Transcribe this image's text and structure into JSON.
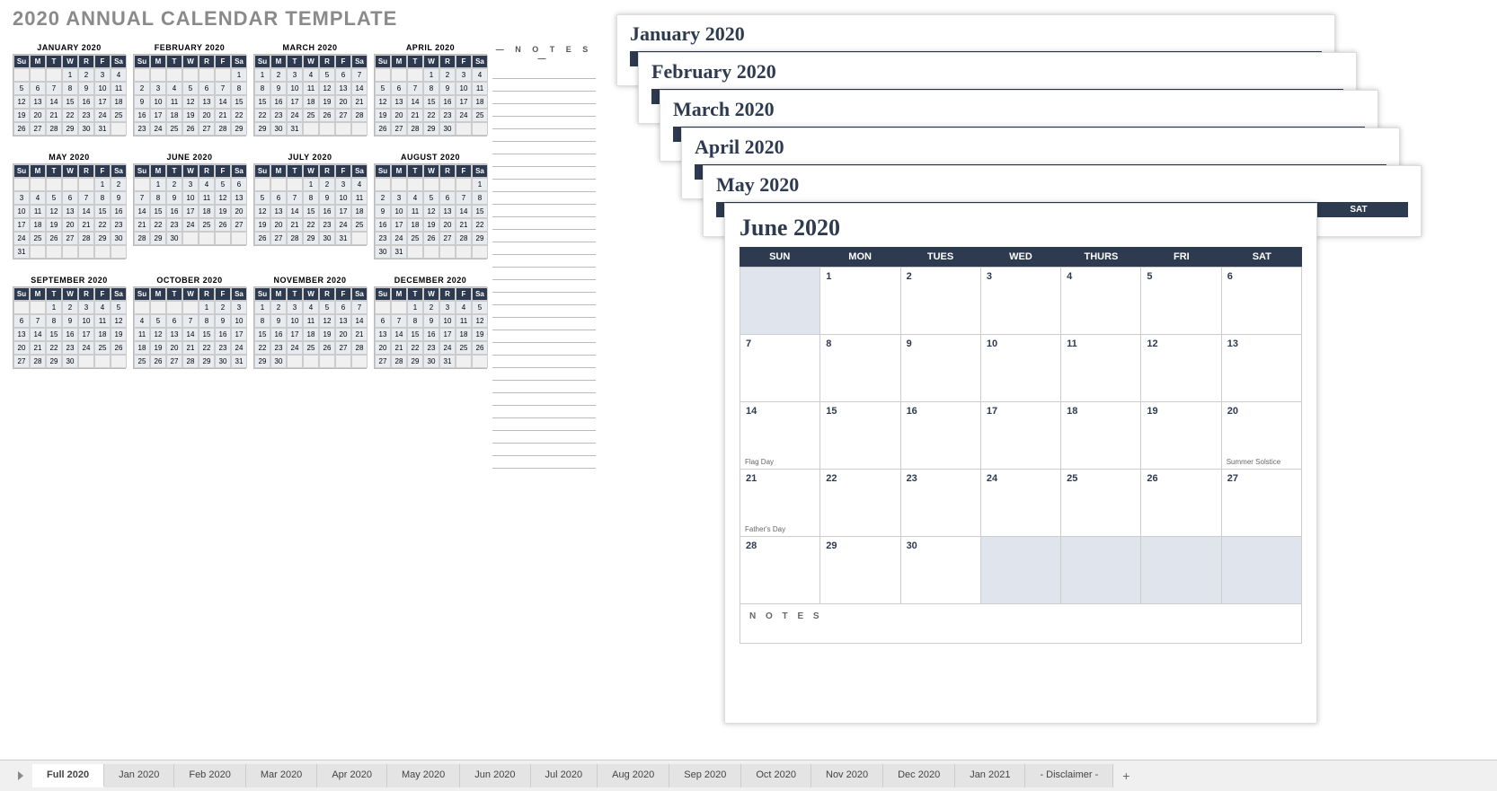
{
  "title": "2020 ANNUAL CALENDAR TEMPLATE",
  "notes_label": "— N O T E S —",
  "mini_day_headers": [
    "Su",
    "M",
    "T",
    "W",
    "R",
    "F",
    "Sa"
  ],
  "months": [
    {
      "name": "JANUARY 2020",
      "start": 3,
      "days": 31
    },
    {
      "name": "FEBRUARY 2020",
      "start": 6,
      "days": 29
    },
    {
      "name": "MARCH 2020",
      "start": 0,
      "days": 31
    },
    {
      "name": "APRIL 2020",
      "start": 3,
      "days": 30
    },
    {
      "name": "MAY 2020",
      "start": 5,
      "days": 31
    },
    {
      "name": "JUNE 2020",
      "start": 1,
      "days": 30
    },
    {
      "name": "JULY 2020",
      "start": 3,
      "days": 31
    },
    {
      "name": "AUGUST 2020",
      "start": 6,
      "days": 31
    },
    {
      "name": "SEPTEMBER 2020",
      "start": 2,
      "days": 30
    },
    {
      "name": "OCTOBER 2020",
      "start": 4,
      "days": 31
    },
    {
      "name": "NOVEMBER 2020",
      "start": 0,
      "days": 30
    },
    {
      "name": "DECEMBER 2020",
      "start": 2,
      "days": 31
    }
  ],
  "stack_headers": [
    "SUN",
    "MON",
    "TUES",
    "WED",
    "THURS",
    "FRI",
    "SAT"
  ],
  "stack": [
    {
      "title": "January 2020"
    },
    {
      "title": "February 2020"
    },
    {
      "title": "March 2020"
    },
    {
      "title": "April 2020"
    },
    {
      "title": "May 2020"
    }
  ],
  "big": {
    "title": "June 2020",
    "headers": [
      "SUN",
      "MON",
      "TUES",
      "WED",
      "THURS",
      "FRI",
      "SAT"
    ],
    "notes_label": "N O T E S",
    "cells": [
      {
        "n": "",
        "inactive": true
      },
      {
        "n": "1"
      },
      {
        "n": "2"
      },
      {
        "n": "3"
      },
      {
        "n": "4"
      },
      {
        "n": "5"
      },
      {
        "n": "6"
      },
      {
        "n": "7"
      },
      {
        "n": "8"
      },
      {
        "n": "9"
      },
      {
        "n": "10"
      },
      {
        "n": "11"
      },
      {
        "n": "12"
      },
      {
        "n": "13"
      },
      {
        "n": "14",
        "ev": "Flag Day"
      },
      {
        "n": "15"
      },
      {
        "n": "16"
      },
      {
        "n": "17"
      },
      {
        "n": "18"
      },
      {
        "n": "19"
      },
      {
        "n": "20",
        "ev": "Summer Solstice"
      },
      {
        "n": "21",
        "ev": "Father's Day"
      },
      {
        "n": "22"
      },
      {
        "n": "23"
      },
      {
        "n": "24"
      },
      {
        "n": "25"
      },
      {
        "n": "26"
      },
      {
        "n": "27"
      },
      {
        "n": "28"
      },
      {
        "n": "29"
      },
      {
        "n": "30"
      },
      {
        "n": "",
        "inactive": true
      },
      {
        "n": "",
        "inactive": true
      },
      {
        "n": "",
        "inactive": true
      },
      {
        "n": "",
        "inactive": true
      }
    ]
  },
  "tabs": [
    "Full 2020",
    "Jan 2020",
    "Feb 2020",
    "Mar 2020",
    "Apr 2020",
    "May 2020",
    "Jun 2020",
    "Jul 2020",
    "Aug 2020",
    "Sep 2020",
    "Oct 2020",
    "Nov 2020",
    "Dec 2020",
    "Jan 2021",
    "- Disclaimer -"
  ],
  "active_tab": 0,
  "plus_label": "+"
}
